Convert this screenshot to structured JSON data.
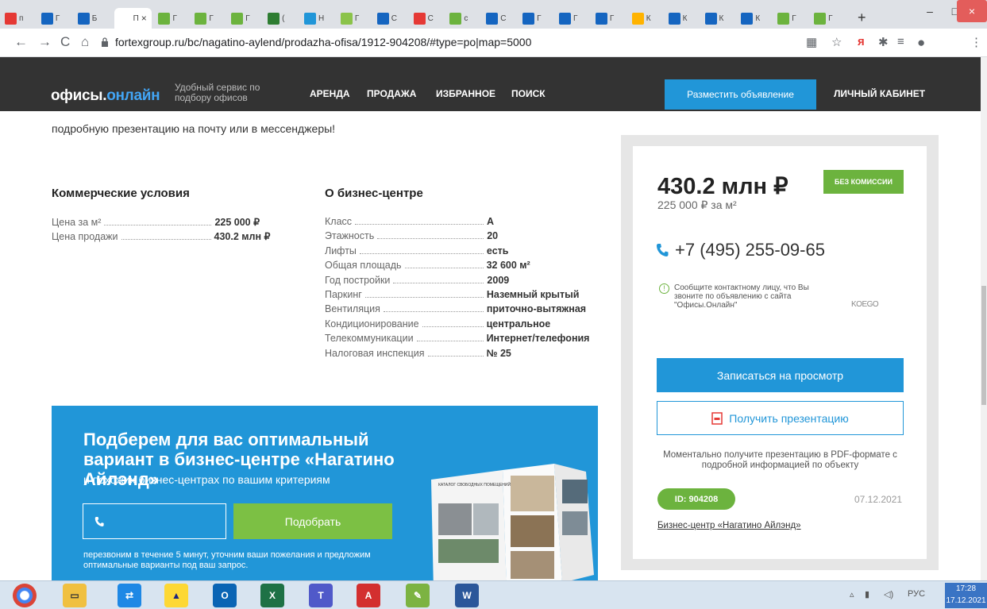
{
  "browser": {
    "active_tab_label": "П",
    "tab_letters": [
      "П",
      "Б",
      "Г",
      "Г",
      "Г",
      "(",
      "Н",
      "Г",
      "С",
      "С",
      "с",
      "С",
      "Г",
      "Г",
      "Г",
      "К",
      "К",
      "К",
      "К",
      "Г",
      "Г"
    ],
    "url": "fortexgroup.ru/bc/nagatino-aylend/prodazha-ofisa/1912-904208/#type=po|map=5000",
    "new_tab": "+",
    "minimize": "–",
    "maximize": "□",
    "close": "×"
  },
  "site": {
    "logo_main": "офисы.",
    "logo_accent": "онлайн",
    "tagline": "Удобный сервис по подбору офисов",
    "nav": [
      "АРЕНДА",
      "ПРОДАЖА",
      "ИЗБРАННОЕ",
      "ПОИСК"
    ],
    "post_button": "Разместить объявление",
    "cabinet": "ЛИЧНЫЙ КАБИНЕТ"
  },
  "intro_text": "подробную презентацию на почту или в мессенджеры!",
  "commercial": {
    "title": "Коммерческие условия",
    "rows": [
      {
        "label": "Цена за м²",
        "value": "225 000 ₽"
      },
      {
        "label": "Цена продажи",
        "value": "430.2 млн ₽"
      }
    ]
  },
  "business_center": {
    "title": "О бизнес-центре",
    "rows": [
      {
        "label": "Класс",
        "value": "A"
      },
      {
        "label": "Этажность",
        "value": "20"
      },
      {
        "label": "Лифты",
        "value": "есть"
      },
      {
        "label": "Общая площадь",
        "value": "32 600 м²"
      },
      {
        "label": "Год постройки",
        "value": "2009"
      },
      {
        "label": "Паркинг",
        "value": "Наземный крытый"
      },
      {
        "label": "Вентиляция",
        "value": "приточно-вытяжная"
      },
      {
        "label": "Кондиционирование",
        "value": "центральное"
      },
      {
        "label": "Телекоммуникации",
        "value": "Интернет/телефония"
      },
      {
        "label": "Налоговая инспекция",
        "value": "№ 25"
      }
    ]
  },
  "card": {
    "price": "430.2 млн ₽",
    "no_commission": "БЕЗ КОМИССИИ",
    "price_per_m": "225 000 ₽ за м²",
    "phone": "+7 (495) 255-09-65",
    "note": "Сообщите контактному лицу, что Вы звоните по объявлению с сайта \"Офисы.Онлайн\"",
    "brand": "KOEGO",
    "view_button": "Записаться на просмотр",
    "presentation_button": "Получить презентацию",
    "presentation_note": "Моментально получите презентацию в PDF-формате с подробной информацией по объекту",
    "id": "ID: 904208",
    "date": "07.12.2021",
    "bc_link": "Бизнес-центр «Нагатино Айлэнд»"
  },
  "banner": {
    "title": "Подберем для вас оптимальный вариант в бизнес-центре «Нагатино Айлэнд»",
    "subtitle": "и похожих бизнес-центрах по вашим критериям",
    "pick_button": "Подобрать",
    "note": "перезвоним в течение 5 минут, уточним ваши пожелания и предложим оптимальные варианты под ваш запрос.",
    "catalog_label": "КАТАЛОГ СВОБОДНЫХ ПОМЕЩЕНИЙ"
  },
  "taskbar": {
    "lang": "РУС",
    "time": "17:28",
    "date": "17.12.2021"
  }
}
